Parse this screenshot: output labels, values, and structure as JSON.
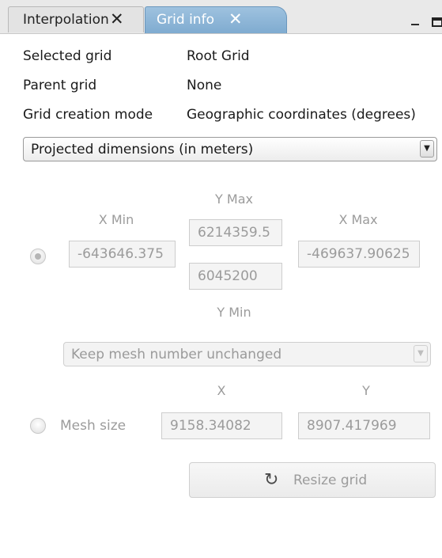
{
  "tabs": [
    {
      "label": "Interpolation",
      "close": "✕",
      "active": false
    },
    {
      "label": "Grid info",
      "close": "✕",
      "active": true
    }
  ],
  "window_controls": {
    "minimize": "_",
    "maximize": "maximize-icon"
  },
  "info": {
    "selected_grid_label": "Selected grid",
    "selected_grid_value": "Root Grid",
    "parent_grid_label": "Parent grid",
    "parent_grid_value": "None",
    "creation_mode_label": "Grid creation mode",
    "creation_mode_value": "Geographic coordinates (degrees)"
  },
  "projection_select": {
    "selected": "Projected dimensions (in meters)",
    "arrow": "▼"
  },
  "bounds": {
    "ymax_label": "Y Max",
    "xmin_label": "X Min",
    "xmax_label": "X Max",
    "ymin_label": "Y Min",
    "ymax_value": "6214359.5",
    "xmin_value": "-643646.375",
    "xmax_value": "-469637.90625",
    "ymin_value": "6045200",
    "radio_selected": true
  },
  "mesh_select": {
    "selected": "Keep mesh number unchanged",
    "arrow": "▼"
  },
  "mesh": {
    "x_label": "X",
    "y_label": "Y",
    "radio_label": "Mesh size",
    "x_value": "9158.34082",
    "y_value": "8907.417969",
    "radio_selected": false
  },
  "resize_button": {
    "label": "Resize grid",
    "icon": "↻"
  },
  "colors": {
    "active_tab": "#8fb6d8",
    "disabled_text": "#9b9b9b"
  }
}
